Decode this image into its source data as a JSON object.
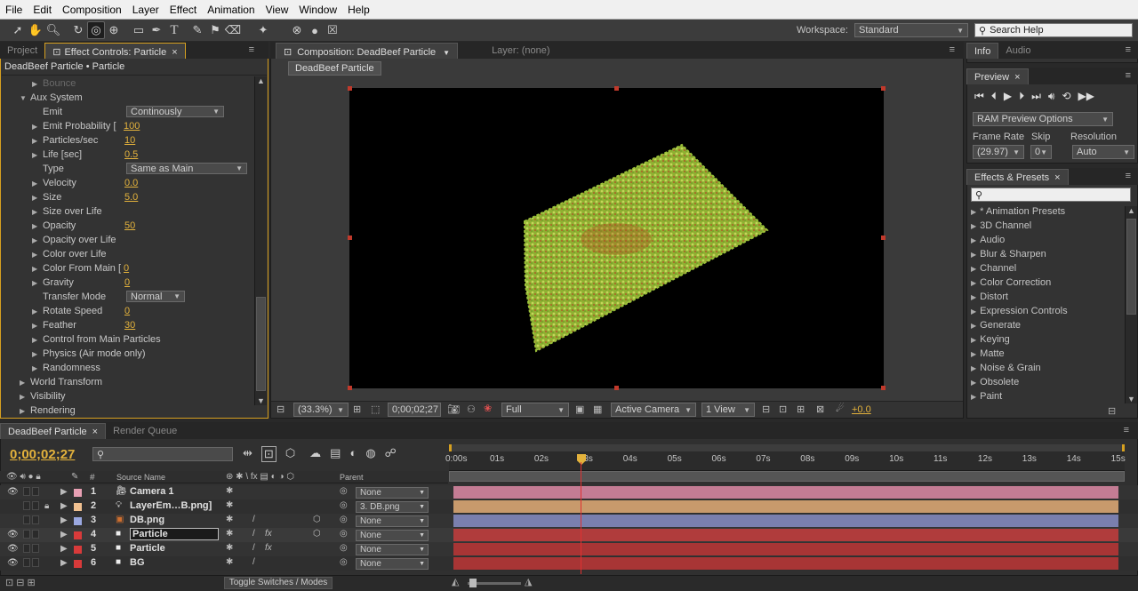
{
  "menu": [
    "File",
    "Edit",
    "Composition",
    "Layer",
    "Effect",
    "Animation",
    "View",
    "Window",
    "Help"
  ],
  "workspace": {
    "label": "Workspace:",
    "value": "Standard"
  },
  "search_help": "Search Help",
  "left_panel": {
    "tabs": [
      "Project",
      "Effect Controls: Particle"
    ],
    "header": "DeadBeef Particle • Particle",
    "rows": [
      {
        "label": "Bounce",
        "indent": 2,
        "dim": true
      },
      {
        "label": "Aux System",
        "indent": 1,
        "open": true
      },
      {
        "label": "Emit",
        "indent": 2,
        "dropdown": "Continously"
      },
      {
        "label": "Emit Probability [",
        "indent": 2,
        "value": "100"
      },
      {
        "label": "Particles/sec",
        "indent": 2,
        "value": "10"
      },
      {
        "label": "Life [sec]",
        "indent": 2,
        "value": "0.5"
      },
      {
        "label": "Type",
        "indent": 2,
        "dropdown": "Same as Main"
      },
      {
        "label": "Velocity",
        "indent": 2,
        "value": "0.0"
      },
      {
        "label": "Size",
        "indent": 2,
        "value": "5.0"
      },
      {
        "label": "Size over Life",
        "indent": 2
      },
      {
        "label": "Opacity",
        "indent": 2,
        "value": "50"
      },
      {
        "label": "Opacity over Life",
        "indent": 2
      },
      {
        "label": "Color over Life",
        "indent": 2
      },
      {
        "label": "Color From Main [",
        "indent": 2,
        "value": "0"
      },
      {
        "label": "Gravity",
        "indent": 2,
        "value": "0"
      },
      {
        "label": "Transfer Mode",
        "indent": 2,
        "dropdown": "Normal"
      },
      {
        "label": "Rotate Speed",
        "indent": 2,
        "value": "0"
      },
      {
        "label": "Feather",
        "indent": 2,
        "value": "30"
      },
      {
        "label": "Control from Main Particles",
        "indent": 2
      },
      {
        "label": "Physics (Air mode only)",
        "indent": 2
      },
      {
        "label": "Randomness",
        "indent": 2
      },
      {
        "label": "World Transform",
        "indent": 1
      },
      {
        "label": "Visibility",
        "indent": 1
      },
      {
        "label": "Rendering",
        "indent": 1
      }
    ]
  },
  "comp": {
    "tab": "Composition: DeadBeef Particle",
    "layer_tab": "Layer: (none)",
    "crumb": "DeadBeef Particle",
    "zoom": "(33.3%)",
    "timecode": "0;00;02;27",
    "resolution": "Full",
    "camera": "Active Camera",
    "views": "1 View",
    "exposure": "+0.0"
  },
  "right": {
    "tabs": [
      "Info",
      "Audio"
    ],
    "preview_tab": "Preview",
    "ram_preview": "RAM Preview Options",
    "frame_rate_label": "Frame Rate",
    "skip_label": "Skip",
    "resolution_label": "Resolution",
    "frame_rate": "(29.97)",
    "skip": "0",
    "resolution": "Auto",
    "effects_tab": "Effects & Presets",
    "effects": [
      "* Animation Presets",
      "3D Channel",
      "Audio",
      "Blur & Sharpen",
      "Channel",
      "Color Correction",
      "Distort",
      "Expression Controls",
      "Generate",
      "Keying",
      "Matte",
      "Noise & Grain",
      "Obsolete",
      "Paint"
    ]
  },
  "timeline": {
    "tabs": [
      "DeadBeef Particle",
      "Render Queue"
    ],
    "timecode": "0;00;02;27",
    "col_num": "#",
    "col_source": "Source Name",
    "col_parent": "Parent",
    "ruler": [
      "0:00s",
      "01s",
      "02s",
      "03s",
      "04s",
      "05s",
      "06s",
      "07s",
      "08s",
      "09s",
      "10s",
      "11s",
      "12s",
      "13s",
      "14s",
      "15s"
    ],
    "toggle": "Toggle Switches / Modes",
    "layers": [
      {
        "num": "1",
        "name": "Camera 1",
        "parent": "None",
        "color": "#e8a0b4",
        "bar": "#c47c94"
      },
      {
        "num": "2",
        "name": "LayerEm…B.png]",
        "parent": "3. DB.png",
        "color": "#f0c090",
        "bar": "#c89a6c"
      },
      {
        "num": "3",
        "name": "DB.png",
        "parent": "None",
        "color": "#9aa8e0",
        "bar": "#7a7fae"
      },
      {
        "num": "4",
        "name": "Particle",
        "parent": "None",
        "color": "#d83a3a",
        "bar": "#b03c3c"
      },
      {
        "num": "5",
        "name": "Particle",
        "parent": "None",
        "color": "#d83a3a",
        "bar": "#a83535"
      },
      {
        "num": "6",
        "name": "BG",
        "parent": "None",
        "color": "#d83a3a",
        "bar": "#a83535"
      }
    ]
  }
}
